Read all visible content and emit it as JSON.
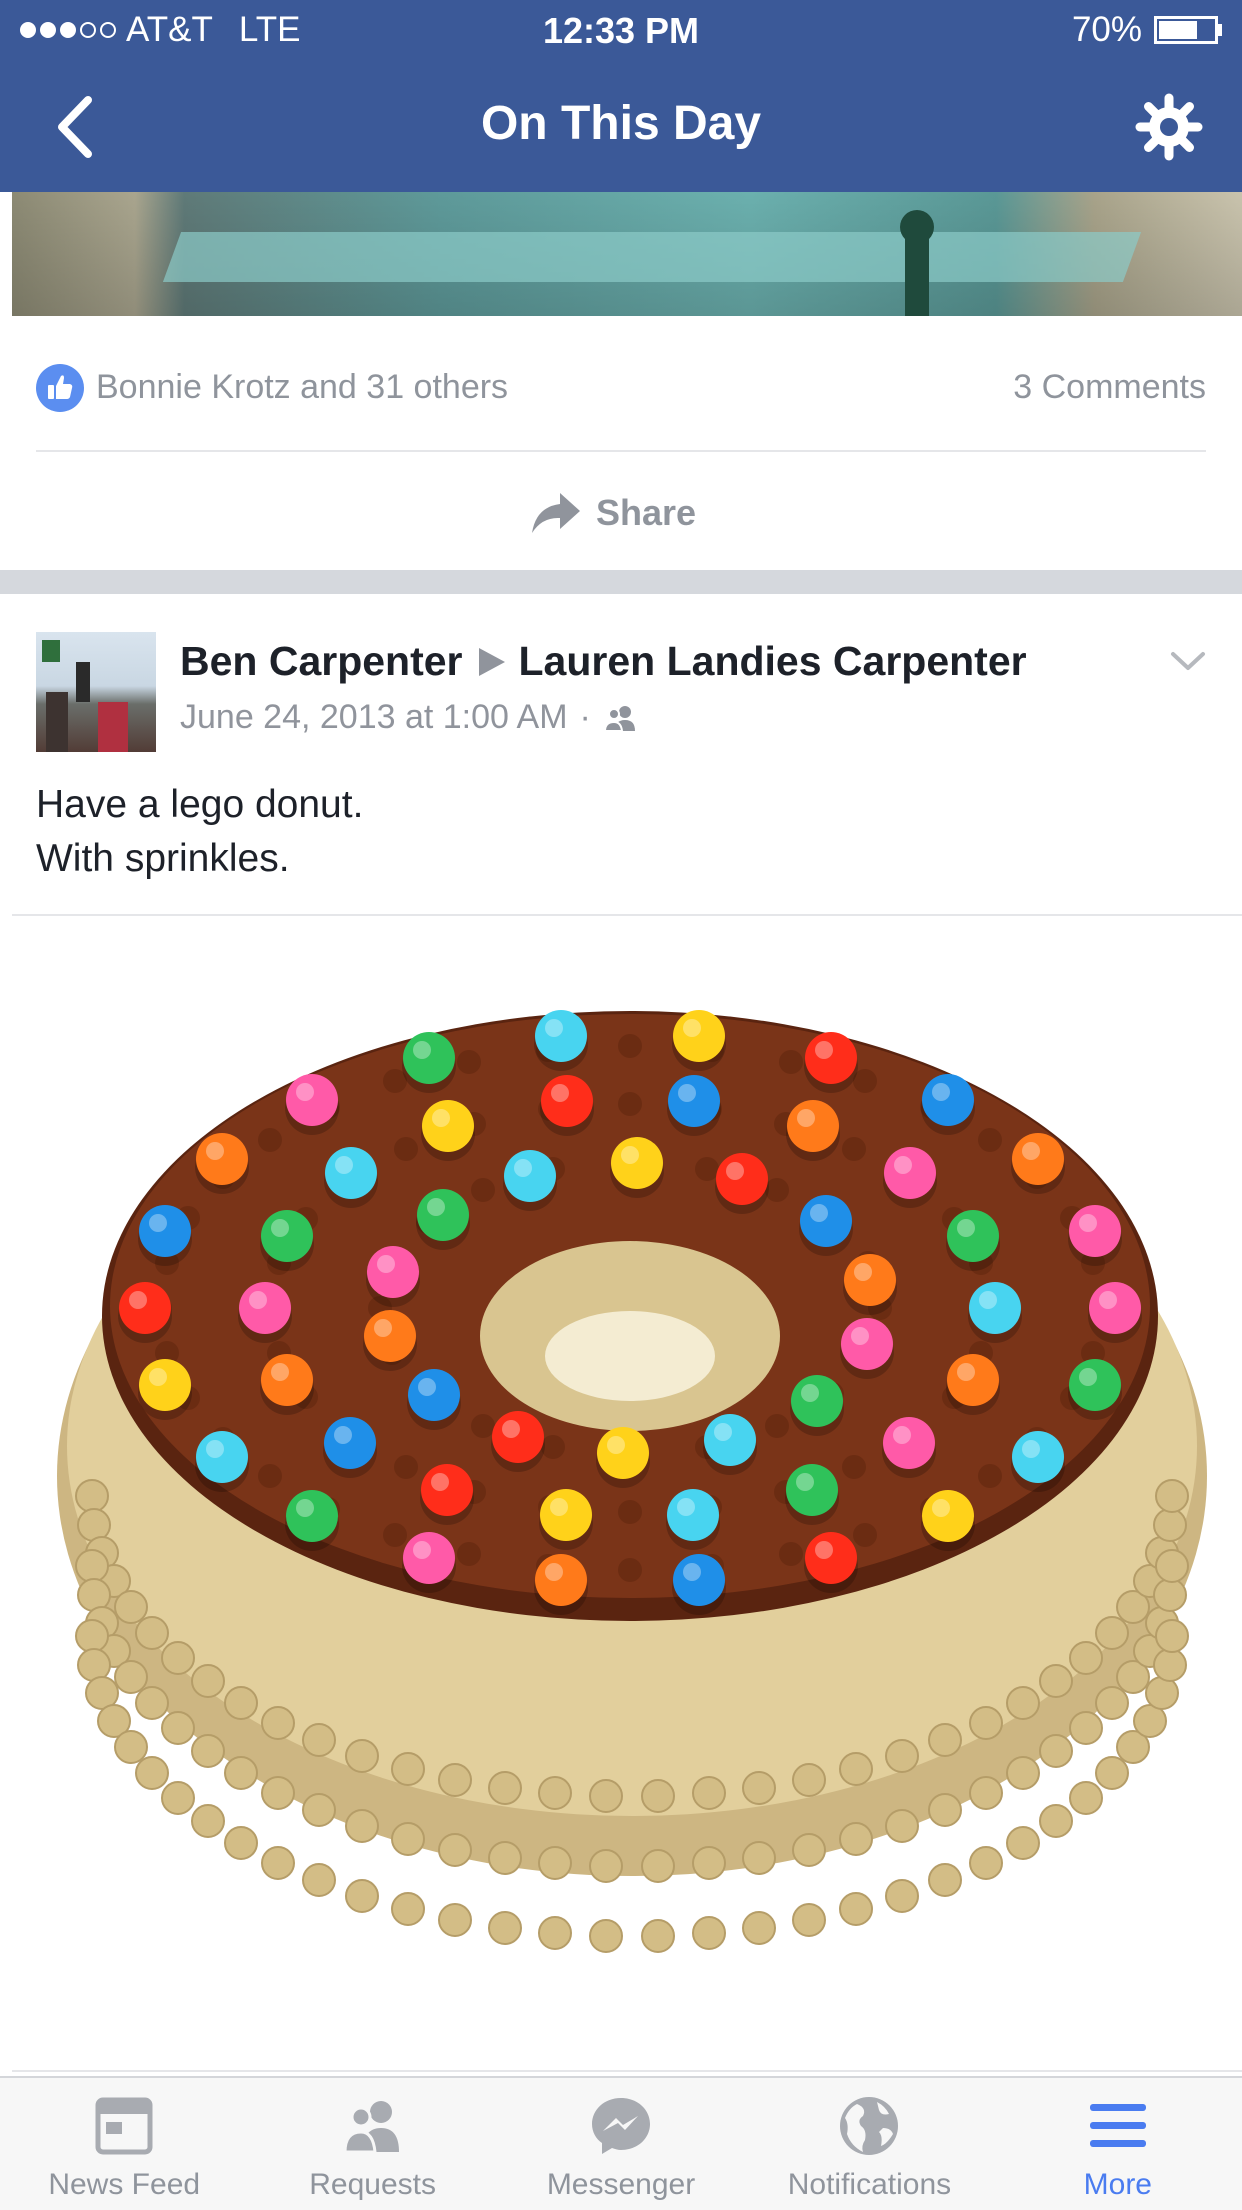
{
  "status_bar": {
    "carrier": "AT&T",
    "network": "LTE",
    "time": "12:33 PM",
    "battery_text": "70%",
    "battery_level": 0.7,
    "signal_bars": 3,
    "signal_max": 5
  },
  "nav": {
    "title": "On This Day",
    "back_icon": "chevron-left-icon",
    "settings_icon": "gear-icon"
  },
  "previous_post": {
    "likes_text": "Bonnie Krotz and 31 others",
    "comments_text": "3 Comments",
    "share_label": "Share"
  },
  "post": {
    "author": "Ben Carpenter",
    "recipient": "Lauren Landies Carpenter",
    "timestamp": "June 24, 2013 at 1:00 AM",
    "separator": "·",
    "audience_icon": "friends-icon",
    "text_lines": [
      "Have a lego donut.",
      "With sprinkles."
    ]
  },
  "tab_bar": {
    "items": [
      {
        "label": "News Feed",
        "icon": "news-feed-icon"
      },
      {
        "label": "Requests",
        "icon": "friend-requests-icon"
      },
      {
        "label": "Messenger",
        "icon": "messenger-icon"
      },
      {
        "label": "Notifications",
        "icon": "globe-icon"
      },
      {
        "label": "More",
        "icon": "menu-icon"
      }
    ],
    "active_index": 4
  },
  "colors": {
    "brand": "#3b5998",
    "like_blue": "#5b8ef0",
    "active_tab": "#4a7cf0",
    "meta_gray": "#90949c"
  }
}
